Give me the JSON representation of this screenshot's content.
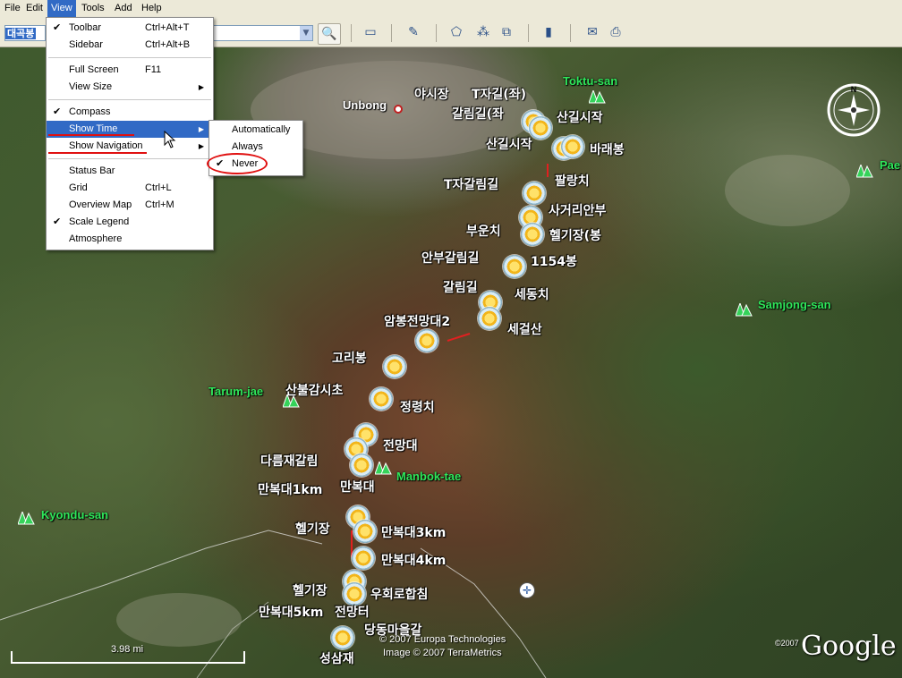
{
  "menubar": {
    "items": [
      {
        "label": "File"
      },
      {
        "label": "Edit"
      },
      {
        "label": "View"
      },
      {
        "label": "Tools"
      },
      {
        "label": "Add"
      },
      {
        "label": "Help"
      }
    ]
  },
  "toolbar": {
    "search_value": "대곡봉"
  },
  "view_menu": {
    "items": [
      {
        "label": "Toolbar",
        "shortcut": "Ctrl+Alt+T",
        "checked": true
      },
      {
        "label": "Sidebar",
        "shortcut": "Ctrl+Alt+B",
        "checked": false
      },
      {
        "label": "Full Screen",
        "shortcut": "F11",
        "checked": false
      },
      {
        "label": "View Size",
        "shortcut": "",
        "submenu": true
      },
      {
        "label": "Compass",
        "shortcut": "",
        "checked": true
      },
      {
        "label": "Show Time",
        "shortcut": "",
        "submenu": true,
        "highlighted": true
      },
      {
        "label": "Show Navigation",
        "shortcut": "",
        "submenu": true
      },
      {
        "label": "Status Bar",
        "shortcut": "",
        "checked": false
      },
      {
        "label": "Grid",
        "shortcut": "Ctrl+L",
        "checked": false
      },
      {
        "label": "Overview Map",
        "shortcut": "Ctrl+M",
        "checked": false
      },
      {
        "label": "Scale Legend",
        "shortcut": "",
        "checked": true
      },
      {
        "label": "Atmosphere",
        "shortcut": "",
        "checked": false
      }
    ]
  },
  "show_time_menu": {
    "items": [
      {
        "label": "Automatically",
        "checked": false
      },
      {
        "label": "Always",
        "checked": false
      },
      {
        "label": "Never",
        "checked": true
      }
    ]
  },
  "map": {
    "waypoint_labels": [
      "야시장",
      "T자길(좌)",
      "갈림길(좌",
      "산길시작",
      "산길시작",
      "바래봉",
      "팔랑치",
      "T자갈림길",
      "사거리안부",
      "부운치",
      "헬기장(봉",
      "안부갈림길",
      "1154봉",
      "갈림길",
      "세동치",
      "암봉전망대2",
      "세걸산",
      "고리봉",
      "산불감시초",
      "정령치",
      "전망대",
      "다름재갈림",
      "만복대",
      "만복대1km",
      "헬기장",
      "만복대3km",
      "만복대4km",
      "헬기장",
      "우회로합침",
      "만복대5km",
      "전망터",
      "당동마을갈",
      "성삼재"
    ],
    "peaks": [
      "Toktu-san",
      "Pae",
      "Samjong-san",
      "Tarum-jae",
      "Manbok-tae",
      "Kyondu-san"
    ],
    "town": "Unbong",
    "scale_label": "3.98 mi",
    "credits": [
      "© 2007 Europa Technologies",
      "Image © 2007 TerraMetrics",
      "©2007"
    ],
    "logo": "Google",
    "compass_north": "N"
  }
}
